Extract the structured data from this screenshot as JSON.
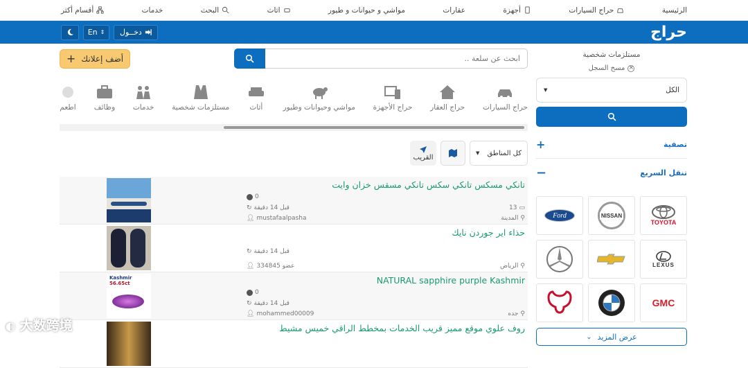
{
  "topnav": {
    "items": [
      "الرئيسية",
      "حراج السيارات",
      "أجهزة",
      "عقارات",
      "مواشي و حيوانات و طيور",
      "اثاث",
      "البحث",
      "خدمات",
      "أقسام أكثر"
    ]
  },
  "header": {
    "logo": "حراج",
    "login": "دخــول",
    "lang": "En"
  },
  "sidebar": {
    "section_title": "مستلزمات شخصية",
    "clear": "مسح السجل",
    "select_value": "الكل",
    "filter_label": "تصفية",
    "quick_label": "تنقل السريع",
    "brands": [
      "TOYOTA",
      "NISSAN",
      "Ford",
      "LEXUS",
      "CHEVROLET",
      "MERCEDES",
      "GMC",
      "BMW",
      "DODGE"
    ],
    "more": "عرض المزيد"
  },
  "search": {
    "placeholder": "ابحث عن سلعة ..",
    "add_button": "أضف إعلانك"
  },
  "categories": [
    "حراج السيارات",
    "حراج العقار",
    "حراج الأجهزة",
    "مواشي وحيوانات وطيور",
    "أثاث",
    "مستلزمات شخصية",
    "خدمات",
    "وظائف",
    "اطعم"
  ],
  "filters": {
    "region": "كل المناطق",
    "nearby": "القريب"
  },
  "ads": [
    {
      "title": "تانكي مسكس تانكي سكس تانكي مسقس خزان وايت",
      "replies": "13",
      "city": "المدينة",
      "time": "قبل 14 دقيقة",
      "user": "mustafaalpasha",
      "price": "0"
    },
    {
      "title": "حذاء اير جوردن نايك",
      "replies": "",
      "city": "الرياض",
      "time": "قبل 14 دقيقة",
      "user": "عضو 334845",
      "price": ""
    },
    {
      "title": "NATURAL sapphire purple Kashmir",
      "replies": "",
      "city": "جده",
      "time": "قبل 14 دقيقة",
      "user": "mohammed00009",
      "price": "0"
    },
    {
      "title": "روف علوي موقع مميز قريب الخدمات بمخطط الراقي خميس مشيط",
      "replies": "",
      "city": "",
      "time": "",
      "user": "",
      "price": ""
    }
  ],
  "thumb_texts": {
    "kashmir": "Kashmir",
    "carat": "56.65ct"
  },
  "watermark": "大数跨境",
  "colors": {
    "brand_blue": "#0d6ebf",
    "title_green": "#1a9b6c",
    "add_yellow": "#f8c971"
  }
}
